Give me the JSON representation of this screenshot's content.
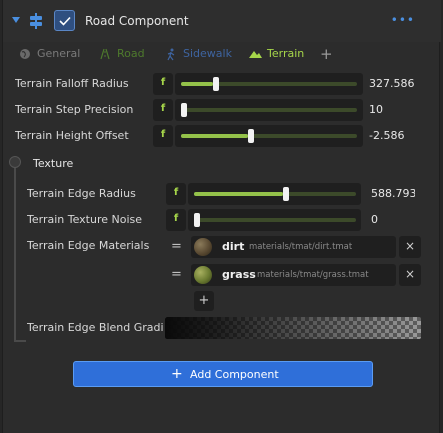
{
  "component": {
    "title": "Road Component",
    "more_label": "•••",
    "enabled": true
  },
  "tabs": [
    {
      "label": "General",
      "icon": "globe-icon"
    },
    {
      "label": "Road",
      "icon": "road-icon"
    },
    {
      "label": "Sidewalk",
      "icon": "walking-person-icon"
    },
    {
      "label": "Terrain",
      "icon": "mountain-icon",
      "active": true
    }
  ],
  "tab_add": "+",
  "properties": [
    {
      "label": "Terrain Falloff Radius",
      "value": "327.586",
      "fill_fraction": 0.18
    },
    {
      "label": "Terrain Step Precision",
      "value": "10",
      "fill_fraction": 0.0
    },
    {
      "label": "Terrain Height Offset",
      "value": "-2.586",
      "fill_fraction": 0.38
    }
  ],
  "texture": {
    "title": "Texture",
    "properties": [
      {
        "label": "Terrain Edge Radius",
        "value": "588.793",
        "fill_fraction": 0.55
      },
      {
        "label": "Terrain Texture Noise",
        "value": "0",
        "fill_fraction": 0.0
      }
    ],
    "materials_label": "Terrain Edge Materials",
    "materials": [
      {
        "name": "dirt",
        "path": "materials/tmat/dirt.tmat",
        "handle": "=",
        "delete": "×"
      },
      {
        "name": "grass",
        "path": "materials/tmat/grass.tmat",
        "handle": "=",
        "delete": "×"
      }
    ],
    "add_material": "+",
    "gradient_label": "Terrain Edge Blend Gradient"
  },
  "add_component_label": "Add Component",
  "f_label": "f",
  "colors": {
    "accent_blue": "#2f6fd9",
    "terrain_green": "#a6d64a",
    "slider_fill": "#94c24a"
  }
}
